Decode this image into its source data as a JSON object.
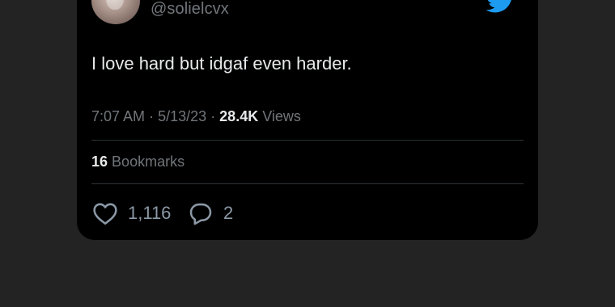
{
  "tweet": {
    "handle": "@solielcvx",
    "text": "I love hard but idgaf even harder.",
    "time": "7:07 AM",
    "date": "5/13/23",
    "views_count": "28.4K",
    "views_label": "Views",
    "separator": "·",
    "bookmarks_count": "16",
    "bookmarks_label": "Bookmarks",
    "likes": "1,116",
    "replies": "2"
  },
  "icons": {
    "brand": "twitter-bird-icon",
    "like": "heart-icon",
    "reply": "speech-bubble-icon"
  },
  "colors": {
    "page_background": "#232323",
    "card_background": "#000000",
    "primary_text": "#e7e9ea",
    "secondary_text": "#71767b",
    "brand_blue": "#1d9bf0",
    "divider": "#2f3336"
  }
}
